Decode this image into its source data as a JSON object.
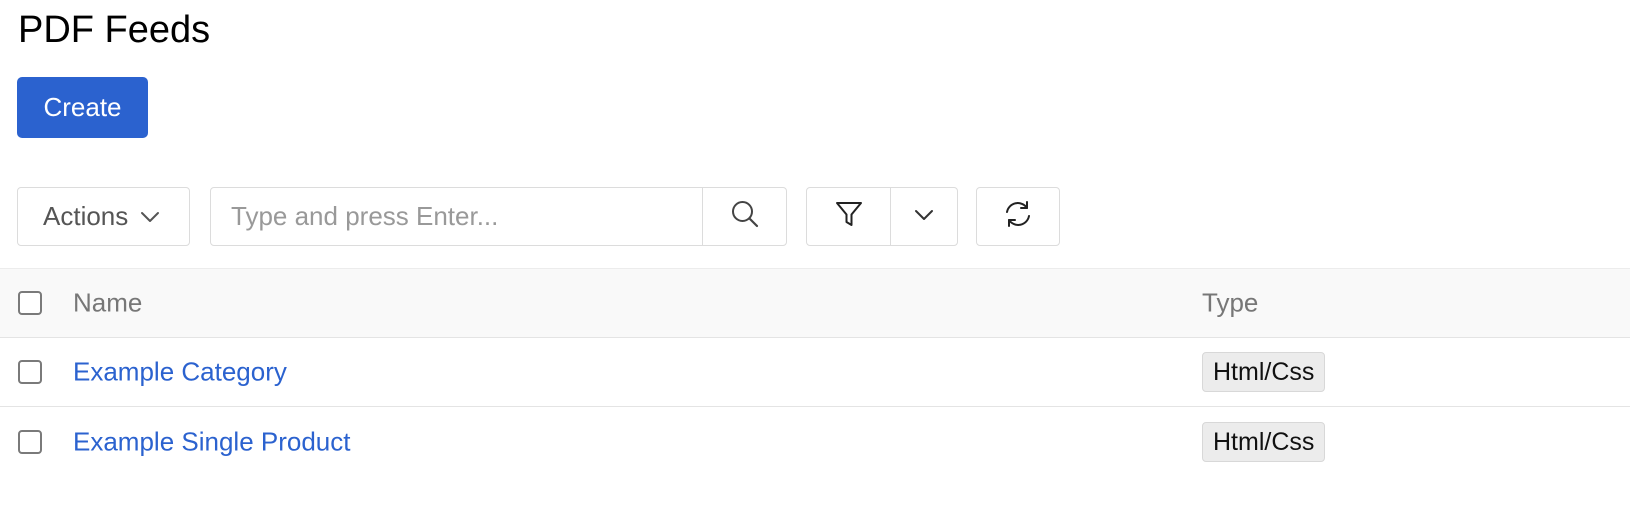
{
  "page": {
    "title": "PDF Feeds"
  },
  "toolbar": {
    "create_label": "Create",
    "actions_label": "Actions",
    "search_placeholder": "Type and press Enter..."
  },
  "icons": {
    "actions_chevron": "chevron-down-icon",
    "search": "search-icon",
    "filter": "filter-icon",
    "filter_toggle": "chevron-down-icon",
    "refresh": "refresh-icon"
  },
  "grid": {
    "columns": {
      "name": "Name",
      "type": "Type"
    },
    "rows": [
      {
        "name": "Example Category",
        "type": "Html/Css"
      },
      {
        "name": "Example Single Product",
        "type": "Html/Css"
      }
    ]
  },
  "colors": {
    "accent": "#2b62cf",
    "border": "#dcdcdc",
    "header_bg": "#f9f9f9"
  }
}
